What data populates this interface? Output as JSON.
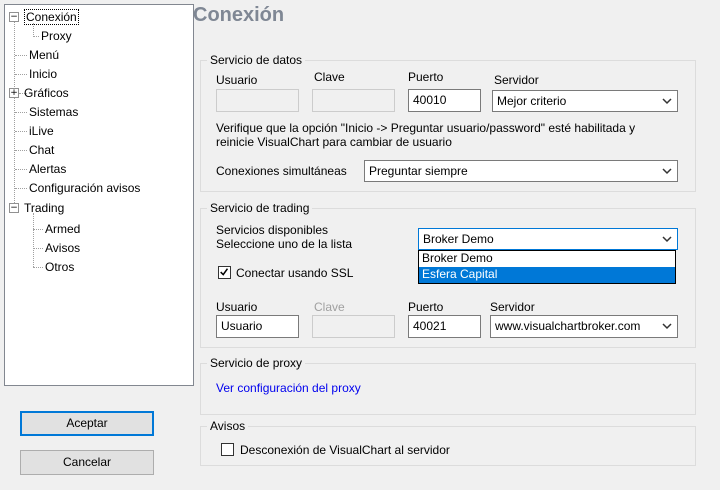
{
  "tree": {
    "items": [
      {
        "label": "Conexión",
        "expanded": true
      },
      {
        "label": "Proxy"
      },
      {
        "label": "Menú"
      },
      {
        "label": "Inicio"
      },
      {
        "label": "Gráficos",
        "expanded": false
      },
      {
        "label": "Sistemas"
      },
      {
        "label": "iLive"
      },
      {
        "label": "Chat"
      },
      {
        "label": "Alertas"
      },
      {
        "label": "Configuración avisos"
      },
      {
        "label": "Trading",
        "expanded": true
      },
      {
        "label": "Armed"
      },
      {
        "label": "Avisos"
      },
      {
        "label": "Otros"
      }
    ]
  },
  "buttons": {
    "accept": "Aceptar",
    "cancel": "Cancelar"
  },
  "page_title": "Conexión",
  "data_service": {
    "legend": "Servicio de datos",
    "user_label": "Usuario",
    "password_label": "Clave",
    "port_label": "Puerto",
    "server_label": "Servidor",
    "user_value": "",
    "password_value": "",
    "port_value": "40010",
    "server_value": "Mejor criterio",
    "note_line1": "Verifique que la opción \"Inicio -> Preguntar usuario/password\" esté habilitada y",
    "note_line2": "reinicie VisualChart para cambiar de usuario",
    "simultaneous_label": "Conexiones simultáneas",
    "simultaneous_value": "Preguntar siempre"
  },
  "trading_service": {
    "legend": "Servicio de trading",
    "available_label": "Servicios disponibles",
    "select_label": "Seleccione uno de la lista",
    "broker_value": "Broker Demo",
    "broker_options": [
      "Broker Demo",
      "Esfera Capital"
    ],
    "highlighted_option": "Esfera Capital",
    "ssl_label": "Conectar usando SSL",
    "ssl_checked": true,
    "user_label": "Usuario",
    "password_label": "Clave",
    "port_label": "Puerto",
    "server_label": "Servidor",
    "user_value": "Usuario",
    "password_value": "",
    "port_value": "40021",
    "server_value": "www.visualchartbroker.com"
  },
  "proxy_service": {
    "legend": "Servicio de proxy",
    "link": "Ver configuración del proxy"
  },
  "notices": {
    "legend": "Avisos",
    "disconnect_label": "Desconexión de VisualChart al servidor",
    "disconnect_checked": false
  },
  "colors": {
    "title": "#7f8794",
    "link": "#0000ee",
    "highlight": "#0078d7"
  }
}
